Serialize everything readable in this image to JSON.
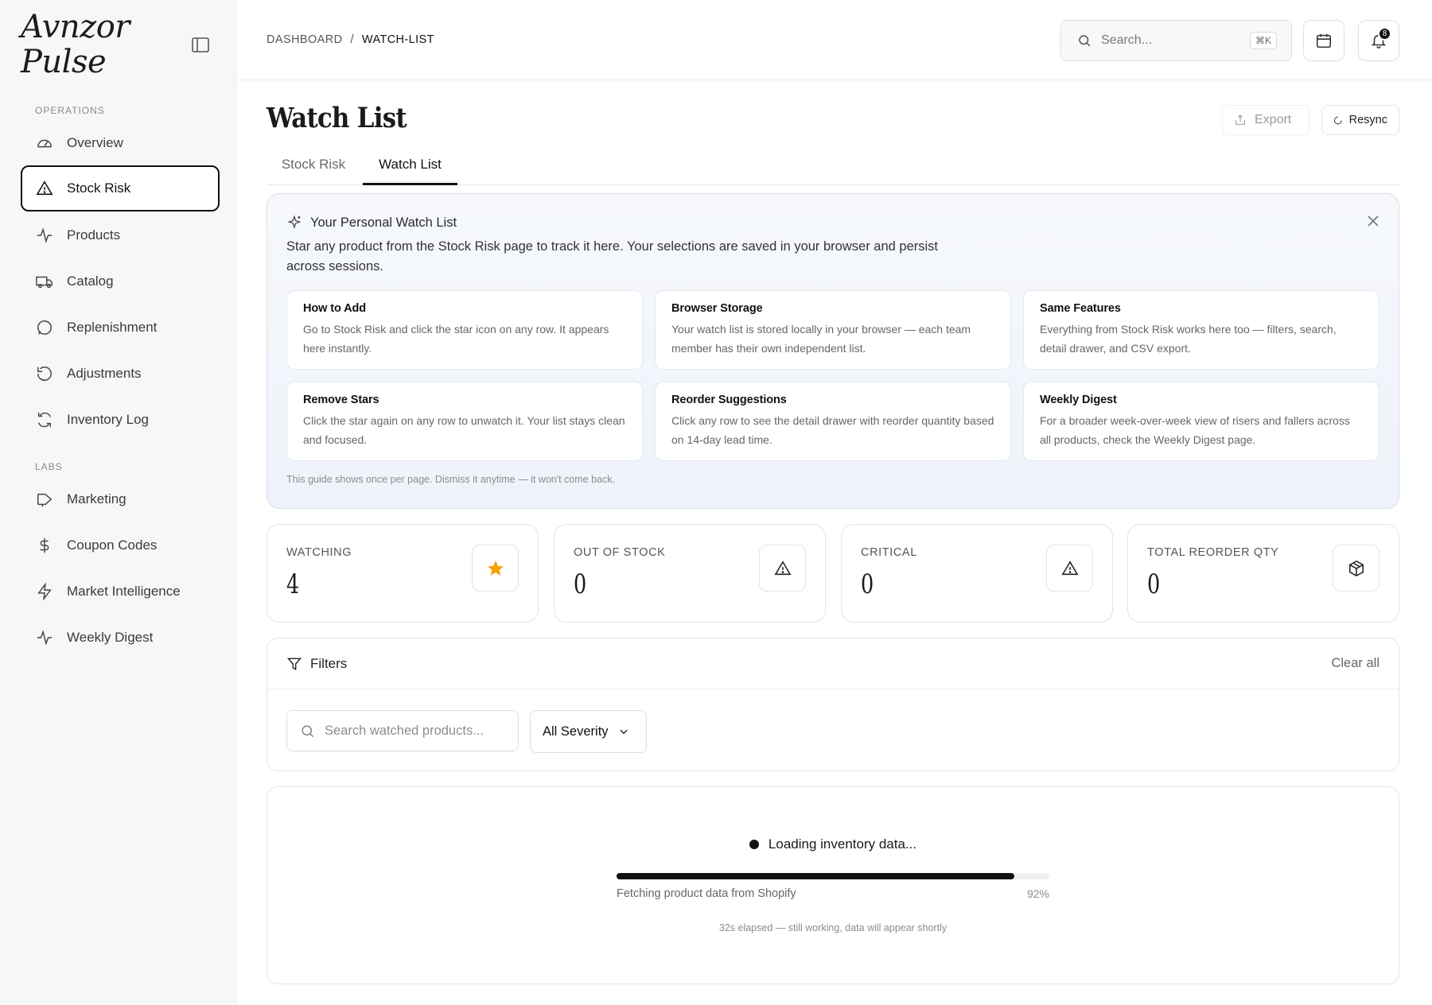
{
  "app": {
    "logo": "Avnzor Pulse"
  },
  "sidebar": {
    "sections": [
      {
        "label": "OPERATIONS"
      },
      {
        "label": "LABS"
      }
    ],
    "items": [
      {
        "label": "Overview",
        "icon": "gauge-icon"
      },
      {
        "label": "Stock Risk",
        "icon": "warning-triangle-icon",
        "active": true
      },
      {
        "label": "Products",
        "icon": "activity-icon"
      },
      {
        "label": "Catalog",
        "icon": "truck-icon"
      },
      {
        "label": "Replenishment",
        "icon": "message-circle-icon"
      },
      {
        "label": "Adjustments",
        "icon": "undo-icon"
      },
      {
        "label": "Inventory Log",
        "icon": "refresh-icon"
      },
      {
        "label": "Marketing",
        "icon": "megaphone-icon"
      },
      {
        "label": "Coupon Codes",
        "icon": "dollar-icon"
      },
      {
        "label": "Market Intelligence",
        "icon": "lightning-icon"
      },
      {
        "label": "Weekly Digest",
        "icon": "activity-icon"
      }
    ]
  },
  "topbar": {
    "breadcrumb": {
      "root": "DASHBOARD",
      "separator": "/",
      "current": "WATCH-LIST"
    },
    "search": {
      "placeholder": "Search...",
      "shortcut": "⌘K"
    },
    "notifications": {
      "count": "8"
    }
  },
  "page": {
    "title": "Watch List",
    "export_label": "Export",
    "resync_label": "Resync",
    "tabs": [
      {
        "label": "Stock Risk"
      },
      {
        "label": "Watch List",
        "active": true
      }
    ]
  },
  "guide": {
    "title": "Your Personal Watch List",
    "description": "Star any product from the Stock Risk page to track it here. Your selections are saved in your browser and persist across sessions.",
    "cards": [
      {
        "title": "How to Add",
        "body": "Go to Stock Risk and click the star icon on any row. It appears here instantly."
      },
      {
        "title": "Browser Storage",
        "body": "Your watch list is stored locally in your browser — each team member has their own independent list."
      },
      {
        "title": "Same Features",
        "body": "Everything from Stock Risk works here too — filters, search, detail drawer, and CSV export."
      },
      {
        "title": "Remove Stars",
        "body": "Click the star again on any row to unwatch it. Your list stays clean and focused."
      },
      {
        "title": "Reorder Suggestions",
        "body": "Click any row to see the detail drawer with reorder quantity based on 14-day lead time."
      },
      {
        "title": "Weekly Digest",
        "body": "For a broader week-over-week view of risers and fallers across all products, check the Weekly Digest page."
      }
    ],
    "footer": "This guide shows once per page. Dismiss it anytime — it won't come back."
  },
  "stats": [
    {
      "label": "WATCHING",
      "value": "4",
      "icon": "star-icon"
    },
    {
      "label": "OUT OF STOCK",
      "value": "0",
      "icon": "warning-triangle-icon"
    },
    {
      "label": "CRITICAL",
      "value": "0",
      "icon": "warning-triangle-icon"
    },
    {
      "label": "TOTAL REORDER QTY",
      "value": "0",
      "icon": "package-icon"
    }
  ],
  "filters": {
    "title": "Filters",
    "clear_label": "Clear all",
    "search_placeholder": "Search watched products...",
    "severity_selected": "All Severity"
  },
  "loading": {
    "title": "Loading inventory data...",
    "progress_label": "Fetching product data from Shopify",
    "progress_pct": "92%",
    "progress_value": 0.92,
    "elapsed": "32s elapsed — still working, data will appear shortly"
  },
  "colors": {
    "accent": "#111111",
    "star": "#f5a100",
    "guide_bg": "#eef3fa"
  }
}
